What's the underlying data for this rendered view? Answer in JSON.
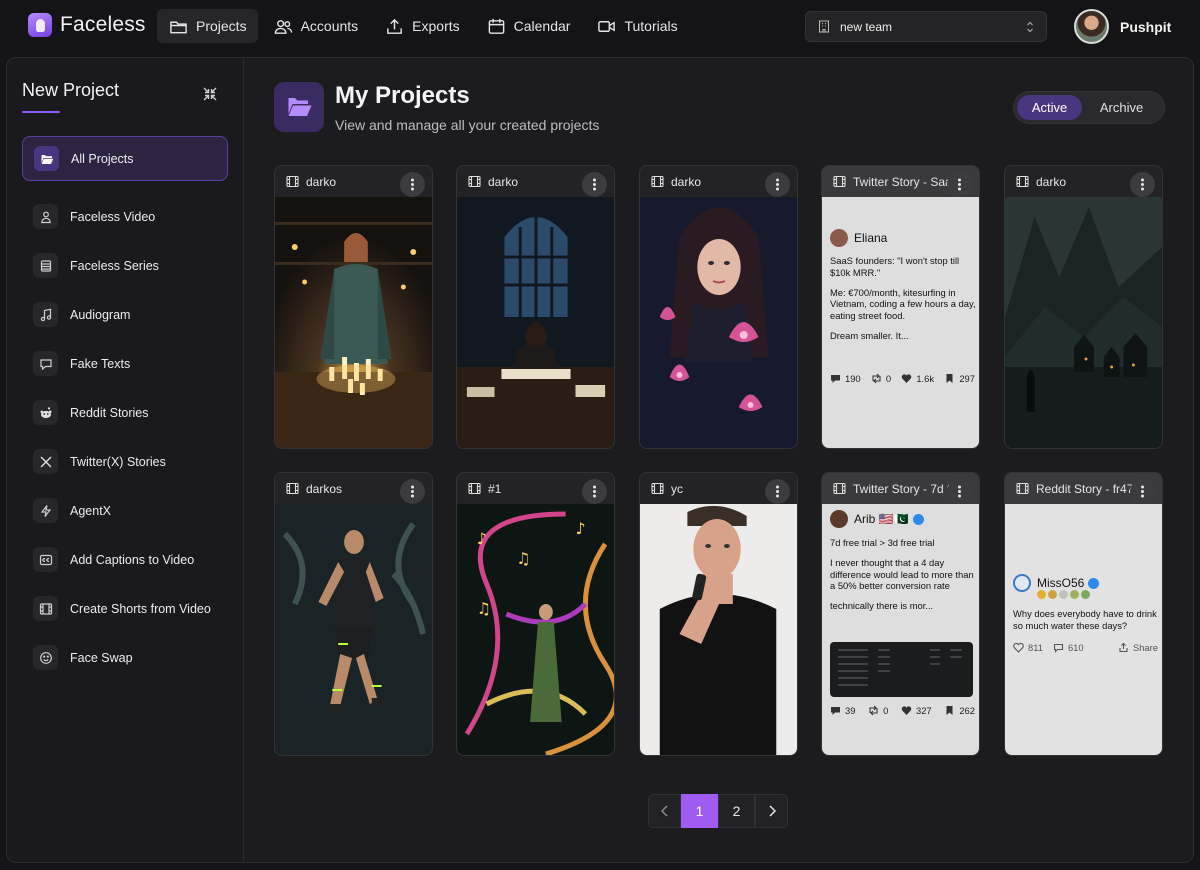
{
  "app": {
    "name": "Faceless"
  },
  "nav": [
    {
      "label": "Projects",
      "icon": "folder-icon",
      "active": true
    },
    {
      "label": "Accounts",
      "icon": "users-icon"
    },
    {
      "label": "Exports",
      "icon": "upload-icon"
    },
    {
      "label": "Calendar",
      "icon": "calendar-icon"
    },
    {
      "label": "Tutorials",
      "icon": "video-icon"
    }
  ],
  "team": {
    "selected": "new team"
  },
  "user": {
    "name": "Pushpit"
  },
  "sidebar": {
    "title": "New Project",
    "items": [
      {
        "label": "All Projects",
        "icon": "folder-open-icon",
        "active": true
      },
      {
        "label": "Faceless Video",
        "icon": "person-icon"
      },
      {
        "label": "Faceless Series",
        "icon": "stack-icon"
      },
      {
        "label": "Audiogram",
        "icon": "music-note-icon"
      },
      {
        "label": "Fake Texts",
        "icon": "chat-bubble-icon"
      },
      {
        "label": "Reddit Stories",
        "icon": "reddit-icon"
      },
      {
        "label": "Twitter(X) Stories",
        "icon": "x-logo-icon"
      },
      {
        "label": "AgentX",
        "icon": "bolt-icon"
      },
      {
        "label": "Add Captions to Video",
        "icon": "cc-icon"
      },
      {
        "label": "Create Shorts from Video",
        "icon": "film-icon"
      },
      {
        "label": "Face Swap",
        "icon": "smiley-icon"
      }
    ]
  },
  "header": {
    "title": "My Projects",
    "subtitle": "View and manage all your created projects",
    "filter": {
      "active_label": "Active",
      "archive_label": "Archive"
    }
  },
  "projects": [
    {
      "title": "darko",
      "type": "video",
      "scene": "candle-witch"
    },
    {
      "title": "darko",
      "type": "video",
      "scene": "reading-window"
    },
    {
      "title": "darko",
      "type": "video",
      "scene": "lotus-woman"
    },
    {
      "title": "Twitter Story - Saa",
      "type": "twitter",
      "author": "Eliana",
      "avatar_color": "#8b5a4a",
      "paragraphs": [
        "SaaS founders: \"I won't stop till $10k MRR.\"",
        "Me: €700/month, kitesurfing in Vietnam, coding a few hours a day, eating street food.",
        "Dream smaller. It..."
      ],
      "stats": {
        "replies": "190",
        "retweets": "0",
        "likes": "1.6k",
        "bookmarks": "297"
      }
    },
    {
      "title": "darko",
      "type": "video",
      "scene": "misty-mountains"
    },
    {
      "title": "darkos",
      "type": "video",
      "scene": "runner"
    },
    {
      "title": "#1",
      "type": "video",
      "scene": "music-swirl"
    },
    {
      "title": "yc",
      "type": "video",
      "scene": "speaker"
    },
    {
      "title": "Twitter Story - 7d f",
      "type": "twitter",
      "author": "Arib 🇺🇸🇵🇰",
      "avatar_color": "#5a3a2a",
      "paragraphs": [
        "7d free trial > 3d free trial",
        "I never thought that a 4 day difference would lead to more than a 50% better conversion rate",
        "technically there is mor..."
      ],
      "stats": {
        "replies": "39",
        "retweets": "0",
        "likes": "327",
        "bookmarks": "262"
      }
    },
    {
      "title": "Reddit Story - fr47",
      "type": "reddit",
      "author": "MissO56",
      "text": "Why does everybody have to drink so much water these days?",
      "stats": {
        "likes": "811",
        "comments": "610",
        "share": "Share"
      }
    }
  ],
  "pagination": {
    "pages": [
      "1",
      "2"
    ],
    "current": "1"
  }
}
